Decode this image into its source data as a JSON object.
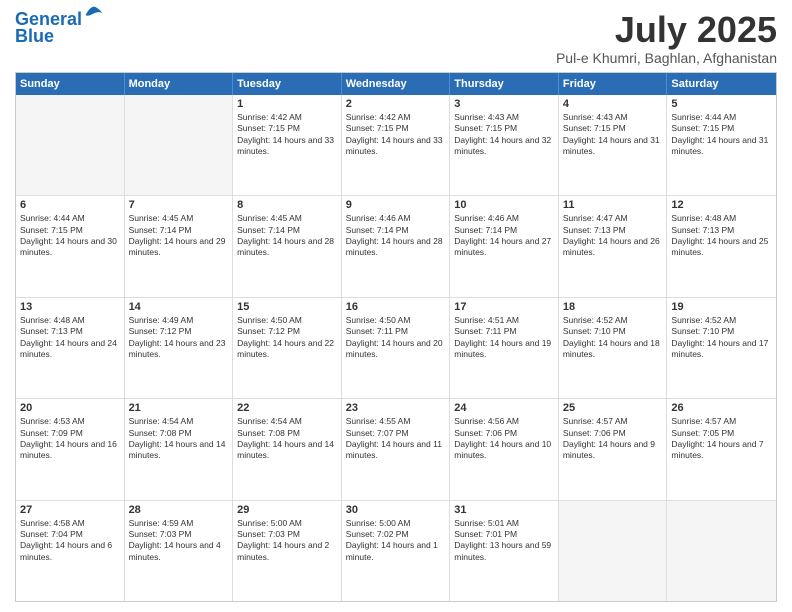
{
  "header": {
    "logo_line1": "General",
    "logo_line2": "Blue",
    "title": "July 2025",
    "subtitle": "Pul-e Khumri, Baghlan, Afghanistan"
  },
  "weekdays": [
    "Sunday",
    "Monday",
    "Tuesday",
    "Wednesday",
    "Thursday",
    "Friday",
    "Saturday"
  ],
  "weeks": [
    [
      {
        "day": "",
        "sunrise": "",
        "sunset": "",
        "daylight": "",
        "empty": true
      },
      {
        "day": "",
        "sunrise": "",
        "sunset": "",
        "daylight": "",
        "empty": true
      },
      {
        "day": "1",
        "sunrise": "Sunrise: 4:42 AM",
        "sunset": "Sunset: 7:15 PM",
        "daylight": "Daylight: 14 hours and 33 minutes."
      },
      {
        "day": "2",
        "sunrise": "Sunrise: 4:42 AM",
        "sunset": "Sunset: 7:15 PM",
        "daylight": "Daylight: 14 hours and 33 minutes."
      },
      {
        "day": "3",
        "sunrise": "Sunrise: 4:43 AM",
        "sunset": "Sunset: 7:15 PM",
        "daylight": "Daylight: 14 hours and 32 minutes."
      },
      {
        "day": "4",
        "sunrise": "Sunrise: 4:43 AM",
        "sunset": "Sunset: 7:15 PM",
        "daylight": "Daylight: 14 hours and 31 minutes."
      },
      {
        "day": "5",
        "sunrise": "Sunrise: 4:44 AM",
        "sunset": "Sunset: 7:15 PM",
        "daylight": "Daylight: 14 hours and 31 minutes."
      }
    ],
    [
      {
        "day": "6",
        "sunrise": "Sunrise: 4:44 AM",
        "sunset": "Sunset: 7:15 PM",
        "daylight": "Daylight: 14 hours and 30 minutes."
      },
      {
        "day": "7",
        "sunrise": "Sunrise: 4:45 AM",
        "sunset": "Sunset: 7:14 PM",
        "daylight": "Daylight: 14 hours and 29 minutes."
      },
      {
        "day": "8",
        "sunrise": "Sunrise: 4:45 AM",
        "sunset": "Sunset: 7:14 PM",
        "daylight": "Daylight: 14 hours and 28 minutes."
      },
      {
        "day": "9",
        "sunrise": "Sunrise: 4:46 AM",
        "sunset": "Sunset: 7:14 PM",
        "daylight": "Daylight: 14 hours and 28 minutes."
      },
      {
        "day": "10",
        "sunrise": "Sunrise: 4:46 AM",
        "sunset": "Sunset: 7:14 PM",
        "daylight": "Daylight: 14 hours and 27 minutes."
      },
      {
        "day": "11",
        "sunrise": "Sunrise: 4:47 AM",
        "sunset": "Sunset: 7:13 PM",
        "daylight": "Daylight: 14 hours and 26 minutes."
      },
      {
        "day": "12",
        "sunrise": "Sunrise: 4:48 AM",
        "sunset": "Sunset: 7:13 PM",
        "daylight": "Daylight: 14 hours and 25 minutes."
      }
    ],
    [
      {
        "day": "13",
        "sunrise": "Sunrise: 4:48 AM",
        "sunset": "Sunset: 7:13 PM",
        "daylight": "Daylight: 14 hours and 24 minutes."
      },
      {
        "day": "14",
        "sunrise": "Sunrise: 4:49 AM",
        "sunset": "Sunset: 7:12 PM",
        "daylight": "Daylight: 14 hours and 23 minutes."
      },
      {
        "day": "15",
        "sunrise": "Sunrise: 4:50 AM",
        "sunset": "Sunset: 7:12 PM",
        "daylight": "Daylight: 14 hours and 22 minutes."
      },
      {
        "day": "16",
        "sunrise": "Sunrise: 4:50 AM",
        "sunset": "Sunset: 7:11 PM",
        "daylight": "Daylight: 14 hours and 20 minutes."
      },
      {
        "day": "17",
        "sunrise": "Sunrise: 4:51 AM",
        "sunset": "Sunset: 7:11 PM",
        "daylight": "Daylight: 14 hours and 19 minutes."
      },
      {
        "day": "18",
        "sunrise": "Sunrise: 4:52 AM",
        "sunset": "Sunset: 7:10 PM",
        "daylight": "Daylight: 14 hours and 18 minutes."
      },
      {
        "day": "19",
        "sunrise": "Sunrise: 4:52 AM",
        "sunset": "Sunset: 7:10 PM",
        "daylight": "Daylight: 14 hours and 17 minutes."
      }
    ],
    [
      {
        "day": "20",
        "sunrise": "Sunrise: 4:53 AM",
        "sunset": "Sunset: 7:09 PM",
        "daylight": "Daylight: 14 hours and 16 minutes."
      },
      {
        "day": "21",
        "sunrise": "Sunrise: 4:54 AM",
        "sunset": "Sunset: 7:08 PM",
        "daylight": "Daylight: 14 hours and 14 minutes."
      },
      {
        "day": "22",
        "sunrise": "Sunrise: 4:54 AM",
        "sunset": "Sunset: 7:08 PM",
        "daylight": "Daylight: 14 hours and 14 minutes."
      },
      {
        "day": "23",
        "sunrise": "Sunrise: 4:55 AM",
        "sunset": "Sunset: 7:07 PM",
        "daylight": "Daylight: 14 hours and 11 minutes."
      },
      {
        "day": "24",
        "sunrise": "Sunrise: 4:56 AM",
        "sunset": "Sunset: 7:06 PM",
        "daylight": "Daylight: 14 hours and 10 minutes."
      },
      {
        "day": "25",
        "sunrise": "Sunrise: 4:57 AM",
        "sunset": "Sunset: 7:06 PM",
        "daylight": "Daylight: 14 hours and 9 minutes."
      },
      {
        "day": "26",
        "sunrise": "Sunrise: 4:57 AM",
        "sunset": "Sunset: 7:05 PM",
        "daylight": "Daylight: 14 hours and 7 minutes."
      }
    ],
    [
      {
        "day": "27",
        "sunrise": "Sunrise: 4:58 AM",
        "sunset": "Sunset: 7:04 PM",
        "daylight": "Daylight: 14 hours and 6 minutes."
      },
      {
        "day": "28",
        "sunrise": "Sunrise: 4:59 AM",
        "sunset": "Sunset: 7:03 PM",
        "daylight": "Daylight: 14 hours and 4 minutes."
      },
      {
        "day": "29",
        "sunrise": "Sunrise: 5:00 AM",
        "sunset": "Sunset: 7:03 PM",
        "daylight": "Daylight: 14 hours and 2 minutes."
      },
      {
        "day": "30",
        "sunrise": "Sunrise: 5:00 AM",
        "sunset": "Sunset: 7:02 PM",
        "daylight": "Daylight: 14 hours and 1 minute."
      },
      {
        "day": "31",
        "sunrise": "Sunrise: 5:01 AM",
        "sunset": "Sunset: 7:01 PM",
        "daylight": "Daylight: 13 hours and 59 minutes."
      },
      {
        "day": "",
        "sunrise": "",
        "sunset": "",
        "daylight": "",
        "empty": true
      },
      {
        "day": "",
        "sunrise": "",
        "sunset": "",
        "daylight": "",
        "empty": true
      }
    ]
  ]
}
